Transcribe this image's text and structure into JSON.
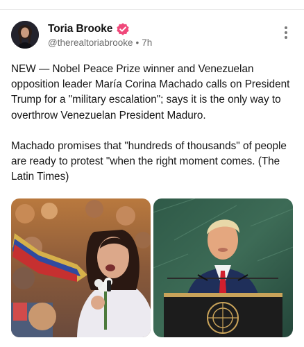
{
  "post": {
    "author": {
      "display_name": "Toria Brooke",
      "handle": "@therealtoriabrooke",
      "verified_badge_icon": "verified-badge-icon",
      "avatar_description": "profile-photo"
    },
    "separator": "•",
    "time": "7h",
    "more_icon": "more-vertical-icon",
    "text": "NEW — Nobel Peace Prize winner and Venezuelan opposition leader María Corina Machado calls on President Trump for a \"military escalation\"; says it is the only way to overthrow Venezuelan President Maduro.\n\nMachado promises that \"hundreds of thousands\" of people are ready to protest \"when the right moment comes. (The Latin Times)",
    "media": [
      {
        "kind": "photo",
        "icon": "photo-machado-rally"
      },
      {
        "kind": "photo",
        "icon": "photo-trump-un-podium"
      }
    ]
  },
  "colors": {
    "verified_badge": "#f0487a",
    "secondary_text": "#6b6b6b"
  }
}
